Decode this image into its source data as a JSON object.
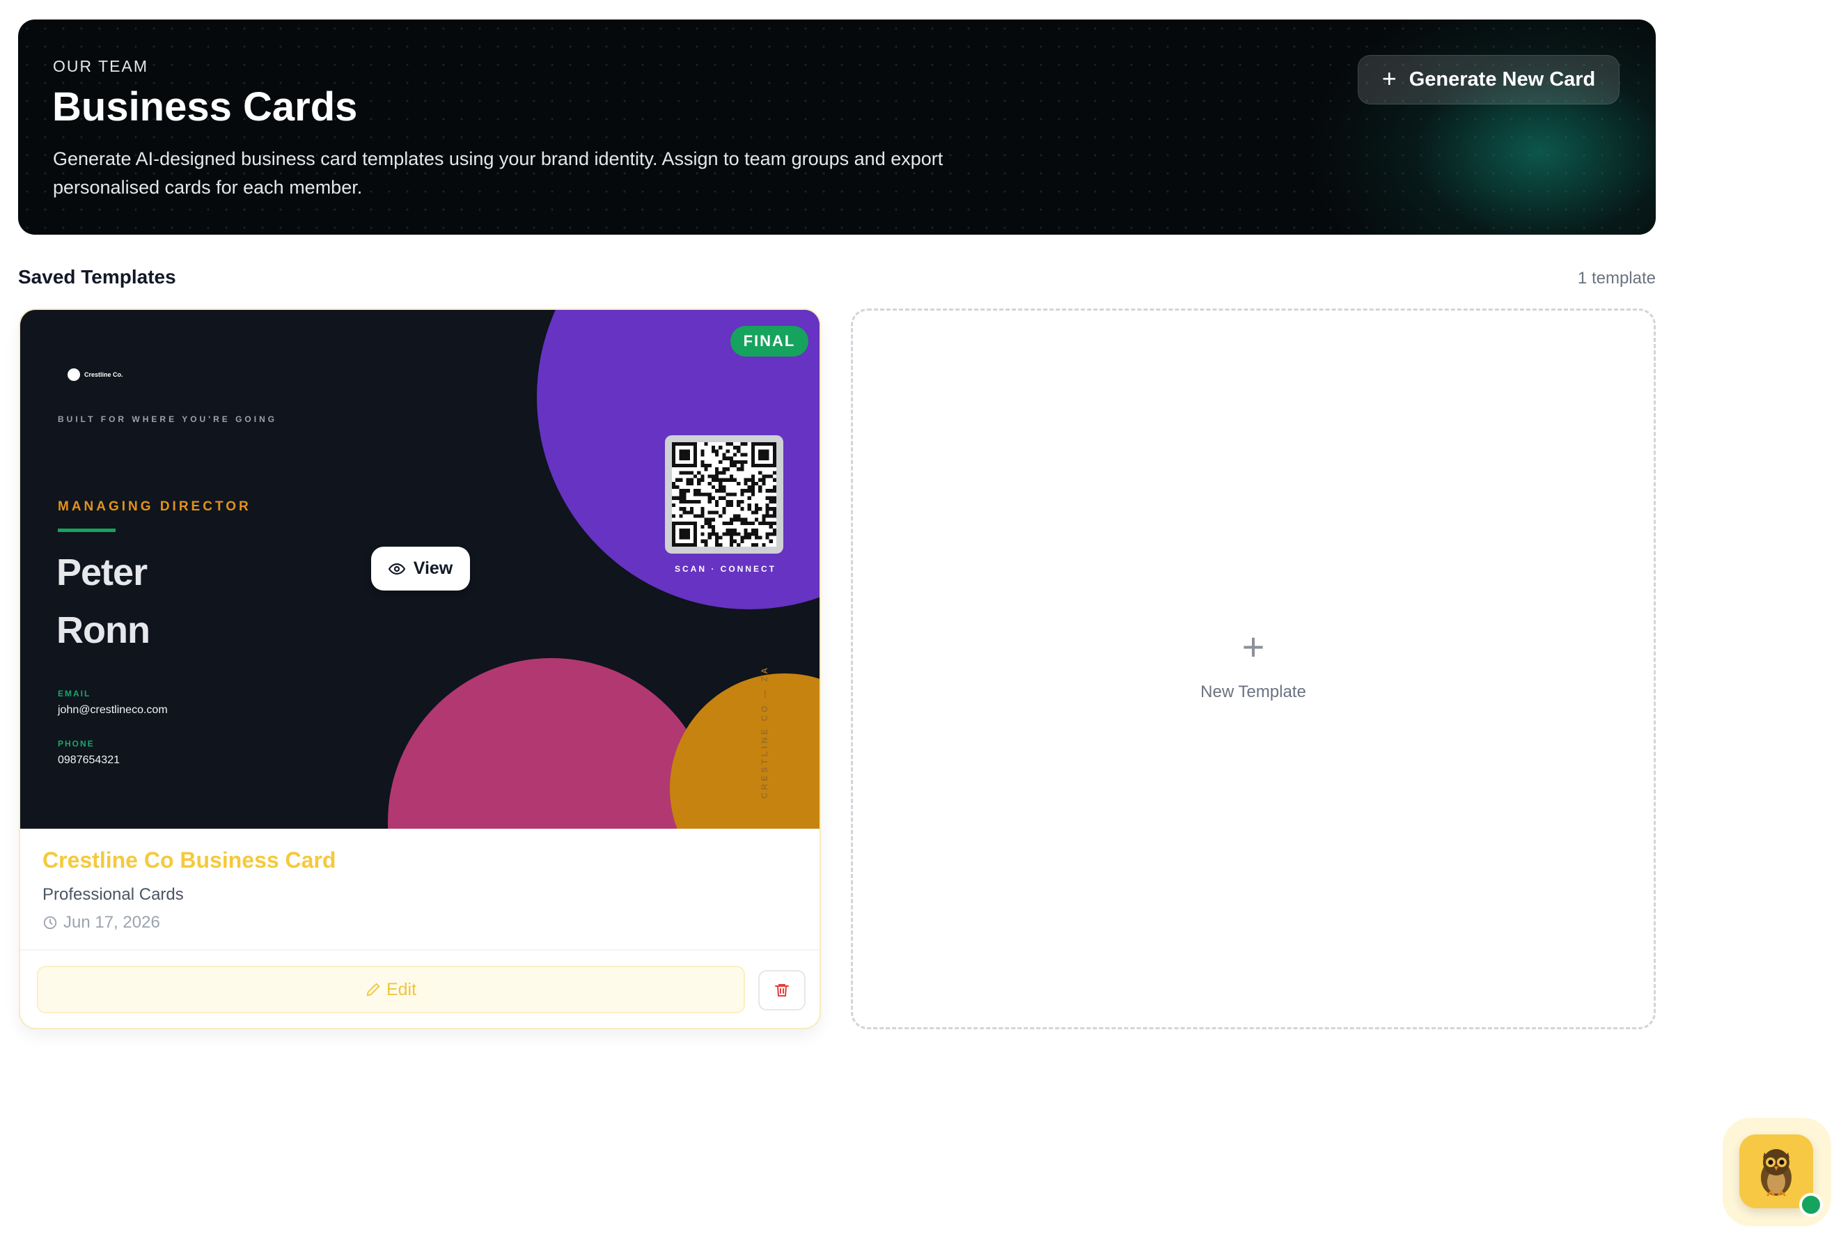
{
  "hero": {
    "eyebrow": "OUR TEAM",
    "title": "Business Cards",
    "description": "Generate AI-designed business card templates using your brand identity. Assign to team groups and export personalised cards for each member.",
    "generate_button": "Generate New Card"
  },
  "section": {
    "title": "Saved Templates",
    "count": "1 template"
  },
  "template": {
    "status": "FINAL",
    "view_label": "View",
    "name": "Crestline Co Business Card",
    "category": "Professional Cards",
    "date": "Jun 17, 2026",
    "edit_label": "Edit",
    "preview": {
      "logo_text": "Crestline Co.",
      "tagline": "BUILT FOR WHERE YOU'RE GOING",
      "role": "MANAGING DIRECTOR",
      "first_name": "Peter",
      "last_name": "Ronn",
      "email_label": "EMAIL",
      "email": "john@crestlineco.com",
      "phone_label": "PHONE",
      "phone": "0987654321",
      "scan_text": "SCAN · CONNECT",
      "vertical_text": "CRESTLINE CO — ZA"
    },
    "colors": {
      "background": "#0f141d",
      "purple": "#6633c2",
      "pink": "#b23872",
      "gold": "#c7830f",
      "green": "#16a35e",
      "accent_title": "#f5c93b"
    }
  },
  "new_template": {
    "label": "New Template"
  },
  "icons": {
    "generate": "plus-icon",
    "view": "eye-icon",
    "date": "clock-icon",
    "edit": "pencil-icon",
    "delete": "trash-icon",
    "assistant": "owl-mascot-icon"
  }
}
